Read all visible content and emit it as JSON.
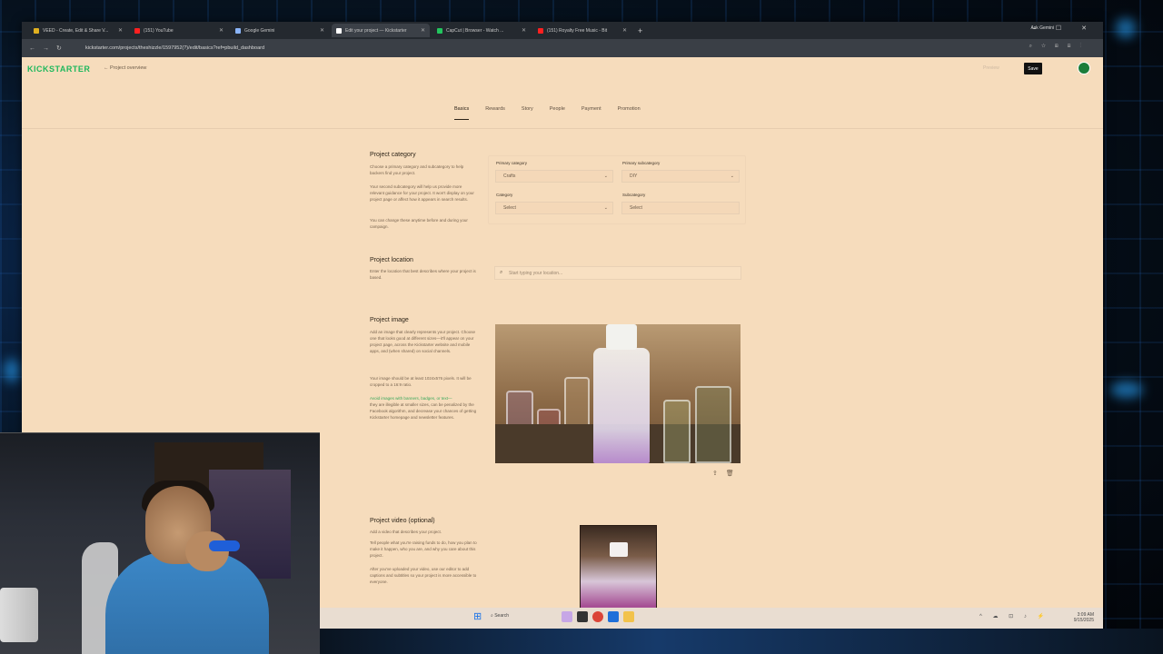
{
  "browser": {
    "tabs": [
      {
        "label": "VEED - Create, Edit & Share V...",
        "color": "#e0b020"
      },
      {
        "label": "(151) YouTube",
        "color": "#ff2020"
      },
      {
        "label": "Google Gemini",
        "color": "#8ab4f8"
      },
      {
        "label": "Edit your project — Kickstarter",
        "color": "#ffffff",
        "active": true
      },
      {
        "label": "CapCut | Browser - Watch ...",
        "color": "#22c55e"
      },
      {
        "label": "(151) Royalty Free Music - Bit",
        "color": "#ff2020"
      }
    ],
    "new_tab": "+",
    "ask_gemini": "Ask Gemini",
    "url": "kickstarter.com/projects/theshizzle/1597952(?)/edit/basics?ref=pbuild_dashboard",
    "window_controls": "– ☐ ✕"
  },
  "header": {
    "logo": "KICKSTARTER",
    "back_link": "← Project overview",
    "preview": "Preview",
    "save": "Save"
  },
  "nav_tabs": [
    "Basics",
    "Rewards",
    "Story",
    "People",
    "Payment",
    "Promotion"
  ],
  "category": {
    "title": "Project category",
    "desc1": "Choose a primary category and subcategory to help backers find your project.",
    "desc2": "Your second subcategory will help us provide more relevant guidance for your project. It won't display on your project page or affect how it appears in search results.",
    "desc3": "You can change these anytime before and during your campaign.",
    "primary_category_label": "Primary category",
    "primary_category_value": "Crafts",
    "primary_subcategory_label": "Primary subcategory",
    "primary_subcategory_value": "DIY",
    "category_label": "Category",
    "category_value": "Select",
    "subcategory_label": "Subcategory",
    "subcategory_value": "Select"
  },
  "location": {
    "title": "Project location",
    "desc": "Enter the location that best describes where your project is based.",
    "placeholder": "Start typing your location..."
  },
  "image": {
    "title": "Project image",
    "desc1": "Add an image that clearly represents your project. Choose one that looks good at different sizes—it'll appear on your project page, across the Kickstarter website and mobile apps, and (when shared) on social channels.",
    "desc2": "Your image should be at least 1024x576 pixels. It will be cropped to a 16:9 ratio.",
    "desc3_green": "Avoid images with banners, badges, or text—",
    "desc3": "they are illegible at smaller sizes, can be penalized by the Facebook algorithm, and decrease your chances of getting Kickstarter homepage and newsletter features."
  },
  "video": {
    "title": "Project video (optional)",
    "desc1": "Add a video that describes your project.",
    "desc2": "Tell people what you're raising funds to do, how you plan to make it happen, who you are, and why you care about this project.",
    "desc3": "After you've uploaded your video, use our editor to add captions and subtitles so your project is more accessible to everyone."
  },
  "taskbar": {
    "search": "Search",
    "time": "3:09 AM",
    "date": "9/15/2025"
  },
  "colors": {
    "page_bg": "#f6dcbc",
    "kickstarter_green": "#1fb85d",
    "taskbar_bg": "#e9ddd1"
  }
}
